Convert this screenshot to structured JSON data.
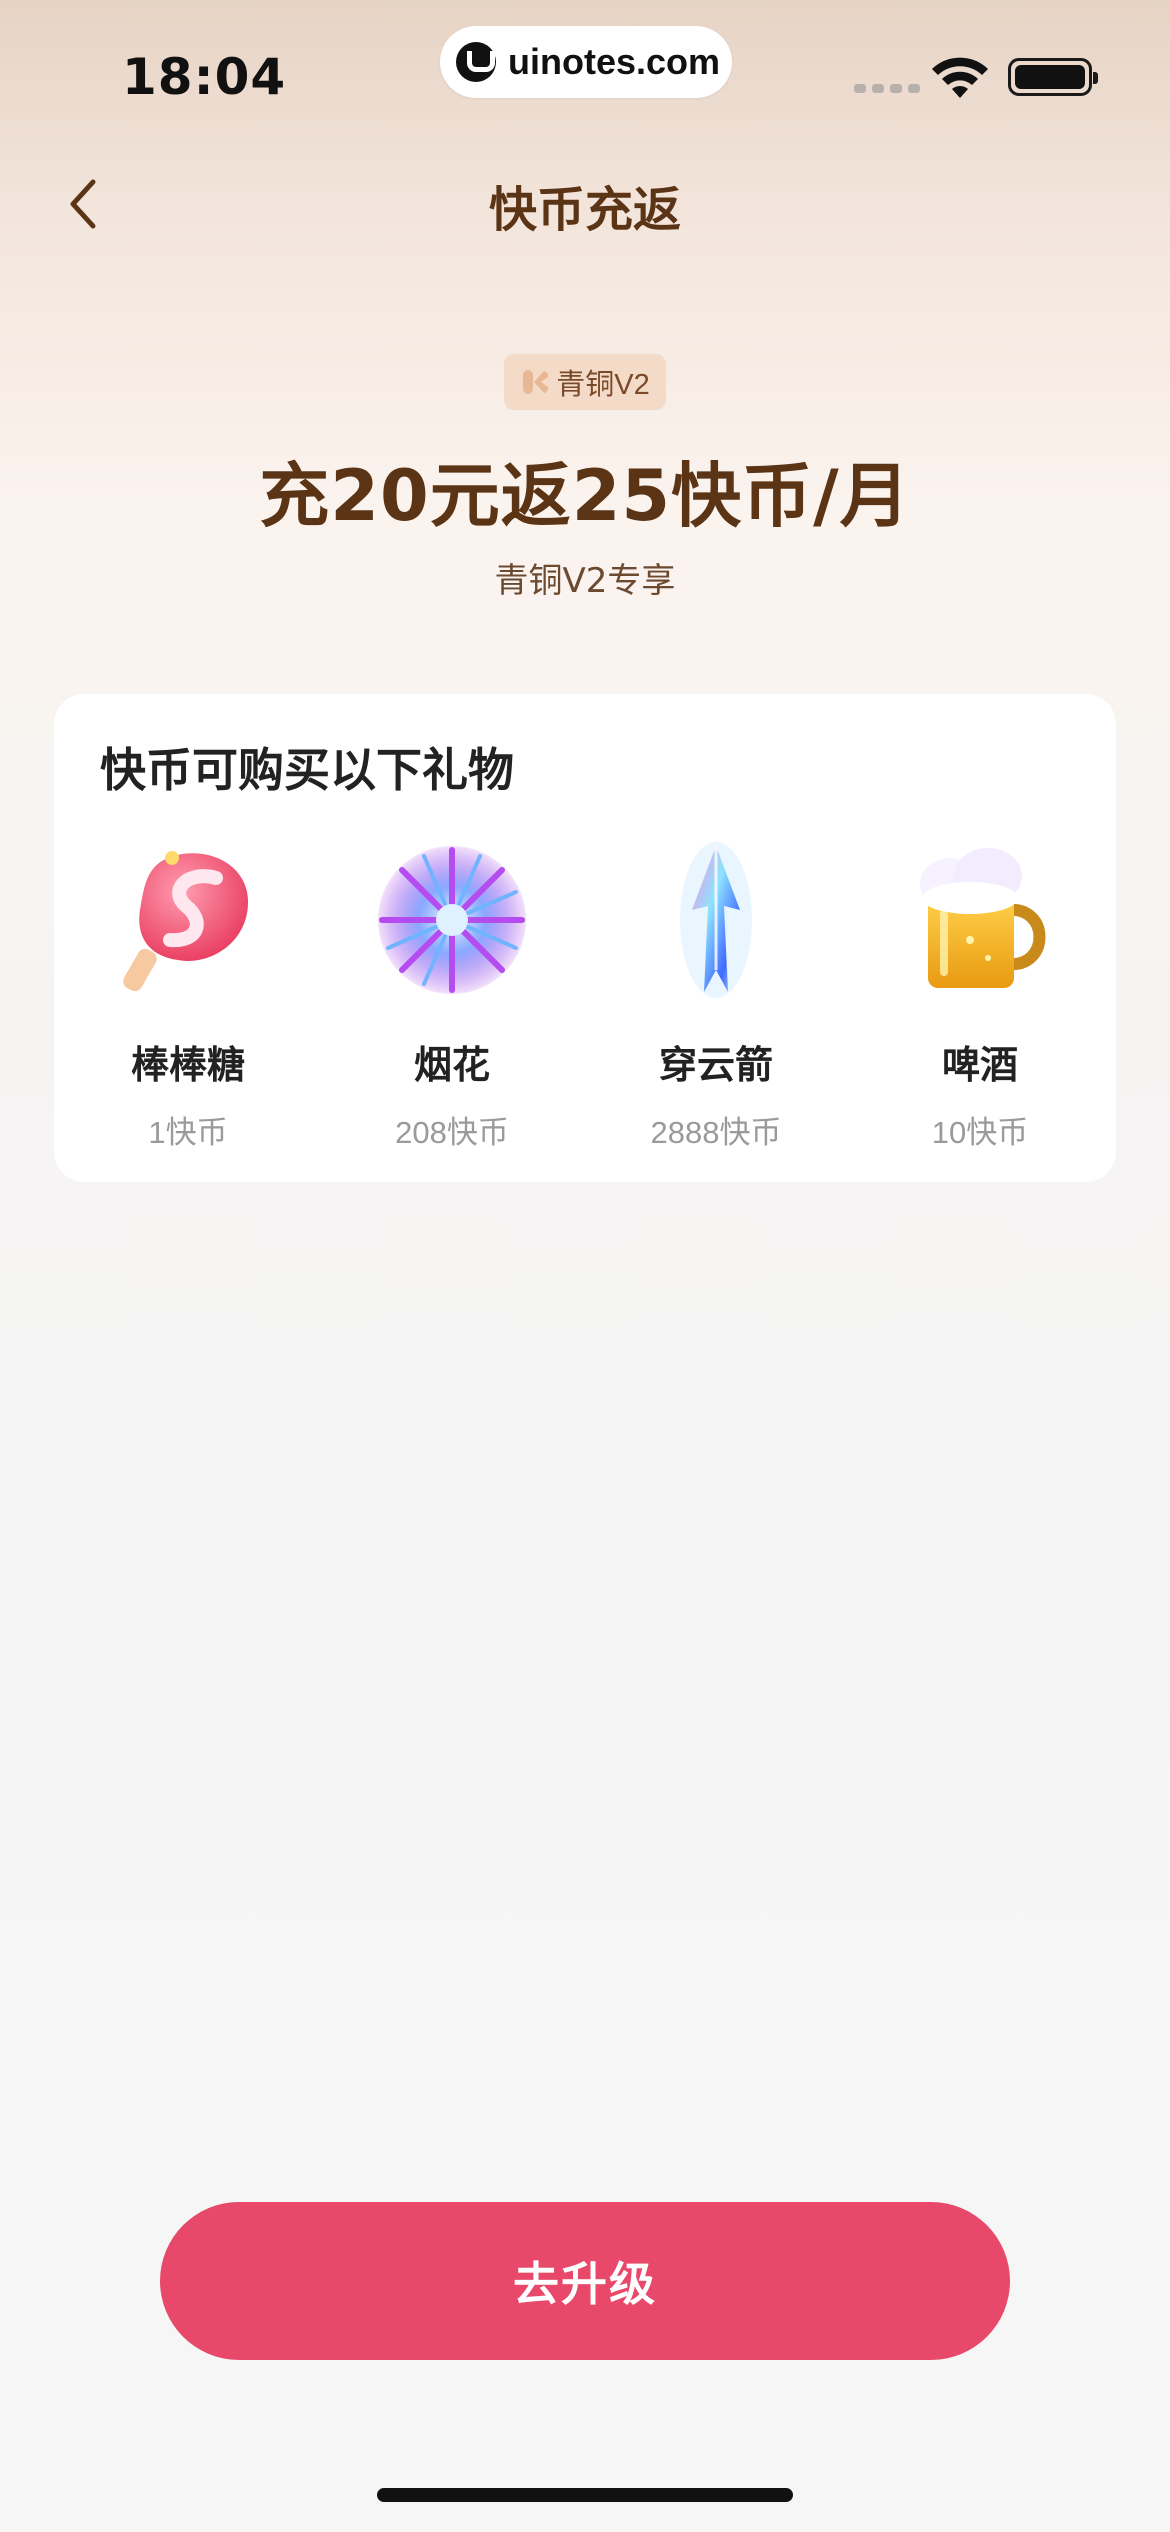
{
  "status_bar": {
    "time": "18:04",
    "url": "uinotes.com"
  },
  "nav": {
    "title": "快币充返",
    "back_icon": "chevron-left-icon"
  },
  "tier": {
    "badge_label": "青铜V2",
    "headline": "充20元返25快币/月",
    "subline": "青铜V2专享"
  },
  "gift_section": {
    "title": "快币可购买以下礼物",
    "items": [
      {
        "name": "棒棒糖",
        "price": "1快币",
        "icon": "lollipop-icon"
      },
      {
        "name": "烟花",
        "price": "208快币",
        "icon": "firework-icon"
      },
      {
        "name": "穿云箭",
        "price": "2888快币",
        "icon": "arrow-crystal-icon"
      },
      {
        "name": "啤酒",
        "price": "10快币",
        "icon": "beer-mug-icon"
      }
    ]
  },
  "cta": {
    "label": "去升级"
  },
  "colors": {
    "accent": "#e8496a",
    "brown_text": "#5b3416",
    "badge_bg": "#f3dbc8"
  }
}
